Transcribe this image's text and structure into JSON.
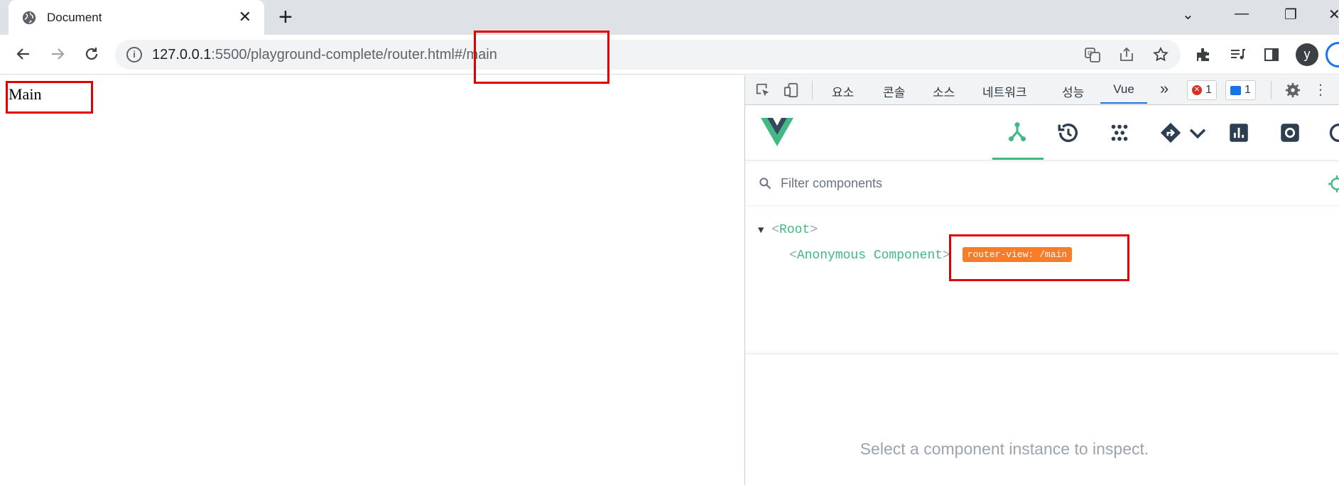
{
  "browser": {
    "tab_title": "Document",
    "tab_close": "✕",
    "new_tab": "+",
    "url_host": "127.0.0.1",
    "url_rest": ":5500/playground-complete/router.html#/main",
    "window_controls": {
      "minimize": "—",
      "restore": "❐",
      "close": "✕",
      "tab_search": "⌄"
    },
    "profile_initial": "y"
  },
  "page": {
    "heading": "Main"
  },
  "devtools": {
    "tabs": [
      "요소",
      "콘솔",
      "소스",
      "네트워크",
      "성능",
      "Vue"
    ],
    "active_tab": "Vue",
    "more_tabs": "»",
    "error_count": "1",
    "message_count": "1",
    "vue": {
      "filter_placeholder": "Filter components",
      "tree": {
        "root_tag": "Root",
        "child_tag": "Anonymous Component",
        "child_badge": "router-view: /main"
      },
      "inspect_message": "Select a component instance to inspect."
    }
  },
  "colors": {
    "vue_green": "#42b883",
    "vue_dark": "#35495e",
    "badge_orange": "#f97316",
    "annotation_red": "#e00000"
  },
  "icons": [
    "globe-icon",
    "close-icon",
    "plus-icon",
    "back-arrow-icon",
    "forward-arrow-icon",
    "reload-icon",
    "info-icon",
    "translate-icon",
    "share-icon",
    "star-icon",
    "extensions-icon",
    "media-icon",
    "side-panel-icon",
    "inspect-icon",
    "device-toggle-icon",
    "components-icon",
    "timeline-icon",
    "pinia-icon",
    "router-icon",
    "performance-icon",
    "settings-icon",
    "search-icon",
    "crosshair-icon"
  ]
}
